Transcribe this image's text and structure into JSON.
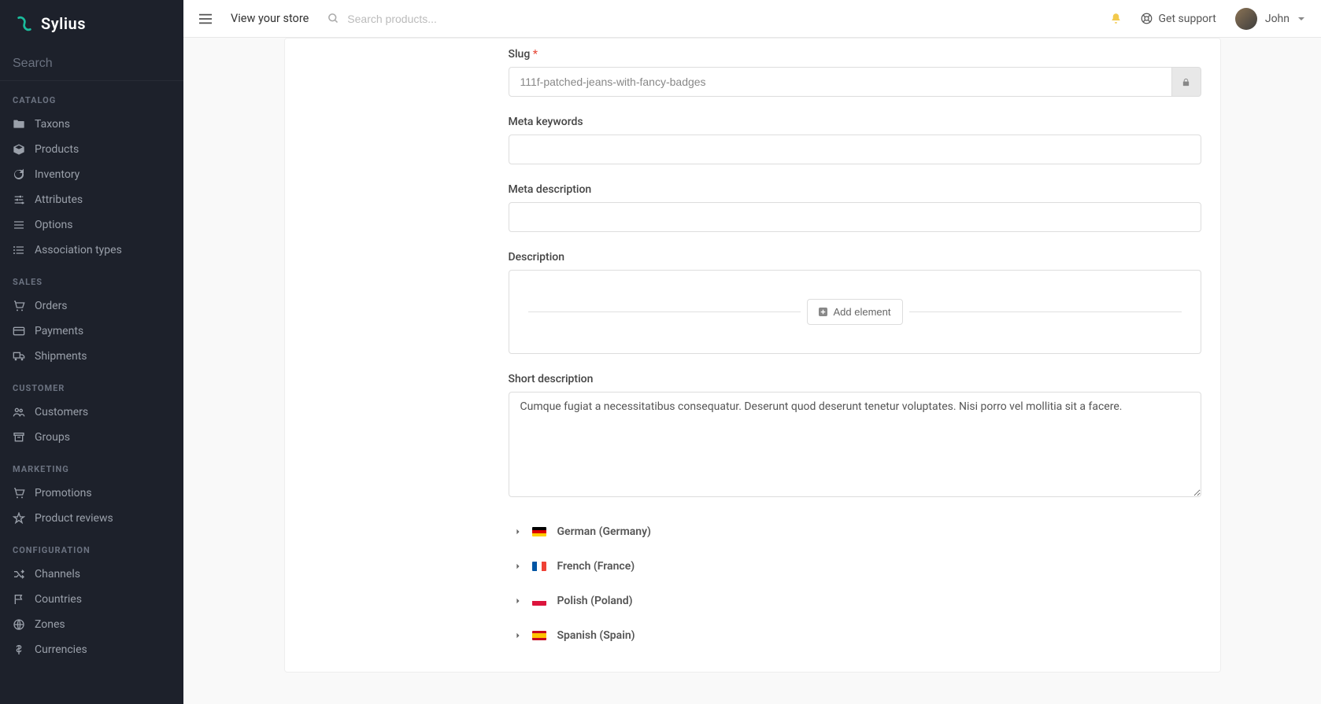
{
  "brand": {
    "name": "Sylius"
  },
  "sidebar": {
    "search_placeholder": "Search",
    "sections": [
      {
        "title": "CATALOG",
        "items": [
          {
            "label": "Taxons",
            "icon": "folder-icon"
          },
          {
            "label": "Products",
            "icon": "cube-icon"
          },
          {
            "label": "Inventory",
            "icon": "history-icon"
          },
          {
            "label": "Attributes",
            "icon": "sliders-icon"
          },
          {
            "label": "Options",
            "icon": "options-icon"
          },
          {
            "label": "Association types",
            "icon": "list-icon"
          }
        ]
      },
      {
        "title": "SALES",
        "items": [
          {
            "label": "Orders",
            "icon": "cart-icon"
          },
          {
            "label": "Payments",
            "icon": "payment-icon"
          },
          {
            "label": "Shipments",
            "icon": "truck-icon"
          }
        ]
      },
      {
        "title": "CUSTOMER",
        "items": [
          {
            "label": "Customers",
            "icon": "users-icon"
          },
          {
            "label": "Groups",
            "icon": "archive-icon"
          }
        ]
      },
      {
        "title": "MARKETING",
        "items": [
          {
            "label": "Promotions",
            "icon": "cart-icon"
          },
          {
            "label": "Product reviews",
            "icon": "star-icon"
          }
        ]
      },
      {
        "title": "CONFIGURATION",
        "items": [
          {
            "label": "Channels",
            "icon": "random-icon"
          },
          {
            "label": "Countries",
            "icon": "flag-icon"
          },
          {
            "label": "Zones",
            "icon": "globe-icon"
          },
          {
            "label": "Currencies",
            "icon": "dollar-icon"
          }
        ]
      }
    ]
  },
  "topbar": {
    "view_store": "View your store",
    "search_placeholder": "Search products...",
    "support": "Get support",
    "user_name": "John"
  },
  "form": {
    "slug": {
      "label": "Slug",
      "value": "111f-patched-jeans-with-fancy-badges"
    },
    "meta_keywords": {
      "label": "Meta keywords",
      "value": ""
    },
    "meta_description": {
      "label": "Meta description",
      "value": ""
    },
    "description": {
      "label": "Description",
      "add_element": "Add element"
    },
    "short_description": {
      "label": "Short description",
      "value": "Cumque fugiat a necessitatibus consequatur. Deserunt quod deserunt tenetur voluptates. Nisi porro vel mollitia sit a facere."
    },
    "languages": [
      {
        "label": "German (Germany)",
        "flag": "flag-de"
      },
      {
        "label": "French (France)",
        "flag": "flag-fr"
      },
      {
        "label": "Polish (Poland)",
        "flag": "flag-pl"
      },
      {
        "label": "Spanish (Spain)",
        "flag": "flag-es"
      }
    ]
  }
}
